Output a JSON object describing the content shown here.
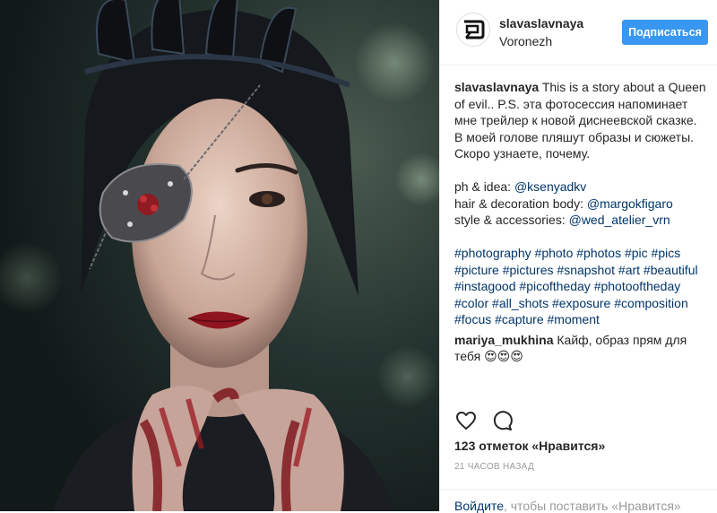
{
  "post": {
    "username": "slavaslavnaya",
    "location": "Voronezh",
    "follow_label": "Подписаться"
  },
  "caption": {
    "username": "slavaslavnaya",
    "line_1": "This is a story about a Queen of evil.. P.S. эта фотосессия напоминает мне трейлер к новой диснеевской сказке.",
    "line_2": "В моей голове пляшут образы и сюжеты.",
    "line_3": "Скоро узнаете, почему.",
    "credit_1_label": "ph & idea:",
    "credit_1_handle": "@ksenyadkv",
    "credit_2_label": "hair & decoration body:",
    "credit_2_handle": "@margokfigaro",
    "credit_3_label": "style & accessories:",
    "credit_3_handle": "@wed_atelier_vrn",
    "hashtags": [
      "#photography",
      "#photo",
      "#photos",
      "#pic",
      "#pics",
      "#picture",
      "#pictures",
      "#snapshot",
      "#art",
      "#beautiful",
      "#instagood",
      "#picoftheday",
      "#photooftheday",
      "#color",
      "#all_shots",
      "#exposure",
      "#composition",
      "#focus",
      "#capture",
      "#moment"
    ]
  },
  "comment": {
    "username": "mariya_mukhina",
    "text": "Кайф, образ прям для тебя 😍😍😍"
  },
  "actions": {
    "like_icon": "heart-outline-icon",
    "comment_icon": "speech-bubble-icon"
  },
  "likes": "123 отметок «Нравится»",
  "timestamp": "21 часов назад",
  "login_prompt": {
    "link": "Войдите",
    "text": ", чтобы поставить «Нравится»"
  },
  "colors": {
    "accent": "#3897f0",
    "link": "#003569",
    "muted": "#999999",
    "text": "#262626"
  }
}
